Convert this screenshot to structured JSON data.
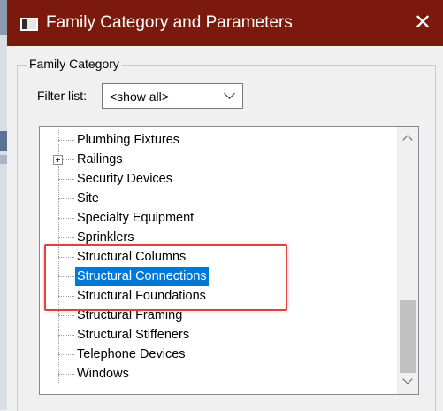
{
  "window": {
    "title": "Family Category and Parameters",
    "close_glyph": "✕"
  },
  "group": {
    "label": "Family Category"
  },
  "filter": {
    "label": "Filter list:",
    "selected": "<show all>"
  },
  "tree": {
    "items": [
      {
        "label": "Plumbing Fixtures",
        "expandable": false,
        "selected": false
      },
      {
        "label": "Railings",
        "expandable": true,
        "selected": false
      },
      {
        "label": "Security Devices",
        "expandable": false,
        "selected": false
      },
      {
        "label": "Site",
        "expandable": false,
        "selected": false
      },
      {
        "label": "Specialty Equipment",
        "expandable": false,
        "selected": false
      },
      {
        "label": "Sprinklers",
        "expandable": false,
        "selected": false
      },
      {
        "label": "Structural Columns",
        "expandable": false,
        "selected": false
      },
      {
        "label": "Structural Connections",
        "expandable": false,
        "selected": true
      },
      {
        "label": "Structural Foundations",
        "expandable": false,
        "selected": false
      },
      {
        "label": "Structural Framing",
        "expandable": false,
        "selected": false
      },
      {
        "label": "Structural Stiffeners",
        "expandable": false,
        "selected": false
      },
      {
        "label": "Telephone Devices",
        "expandable": false,
        "selected": false
      },
      {
        "label": "Windows",
        "expandable": false,
        "selected": false
      }
    ]
  },
  "icons": {
    "window": "app-window-icon",
    "close": "close-icon",
    "dropdown": "chevron-down-icon",
    "expand": "plus-expander-icon",
    "scroll_up": "scroll-up-arrow-icon",
    "scroll_down": "scroll-down-arrow-icon"
  },
  "colors": {
    "titlebar": "#7b1a0c",
    "selection": "#0078d7",
    "annotation": "#e04040"
  }
}
